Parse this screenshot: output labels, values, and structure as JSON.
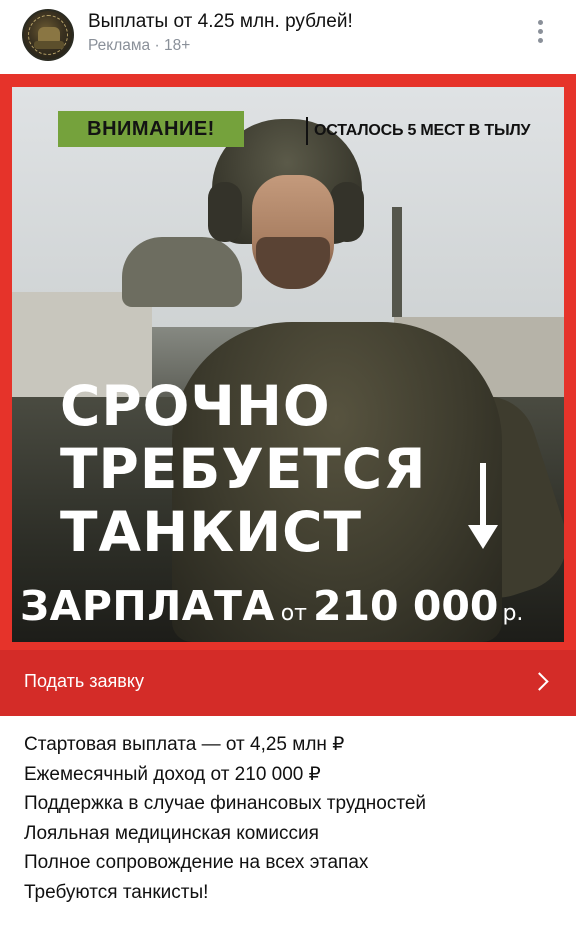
{
  "header": {
    "title": "Выплаты от 4.25 млн. рублей!",
    "meta": "Реклама · 18+",
    "avatar_icon": "unit-emblem-avatar",
    "more_icon": "vertical-dots-icon"
  },
  "ad": {
    "badge": "ВНИМАНИЕ!",
    "seats_note": "ОСТАЛОСЬ 5 МЕСТ В ТЫЛУ",
    "headline": [
      "СРОЧНО",
      "ТРЕБУЕТСЯ",
      "ТАНКИСТ"
    ],
    "arrow_icon": "arrow-down-icon",
    "salary_word": "ЗАРПЛАТА",
    "salary_from": "от",
    "salary_amount": "210 000",
    "salary_currency": "р.",
    "colors": {
      "banner_red": "#e6332a",
      "badge_green": "#75a23c",
      "cta_red": "#d42c28"
    }
  },
  "cta": {
    "label": "Подать заявку",
    "chevron_icon": "chevron-right-icon"
  },
  "body_lines": [
    "Стартовая выплата — от 4,25 млн ₽",
    "Ежемесячный доход от 210 000 ₽",
    "Поддержка в случае финансовых трудностей",
    "Лояльная медицинская комиссия",
    "Полное сопровождение на всех этапах",
    "Требуются танкисты!"
  ]
}
